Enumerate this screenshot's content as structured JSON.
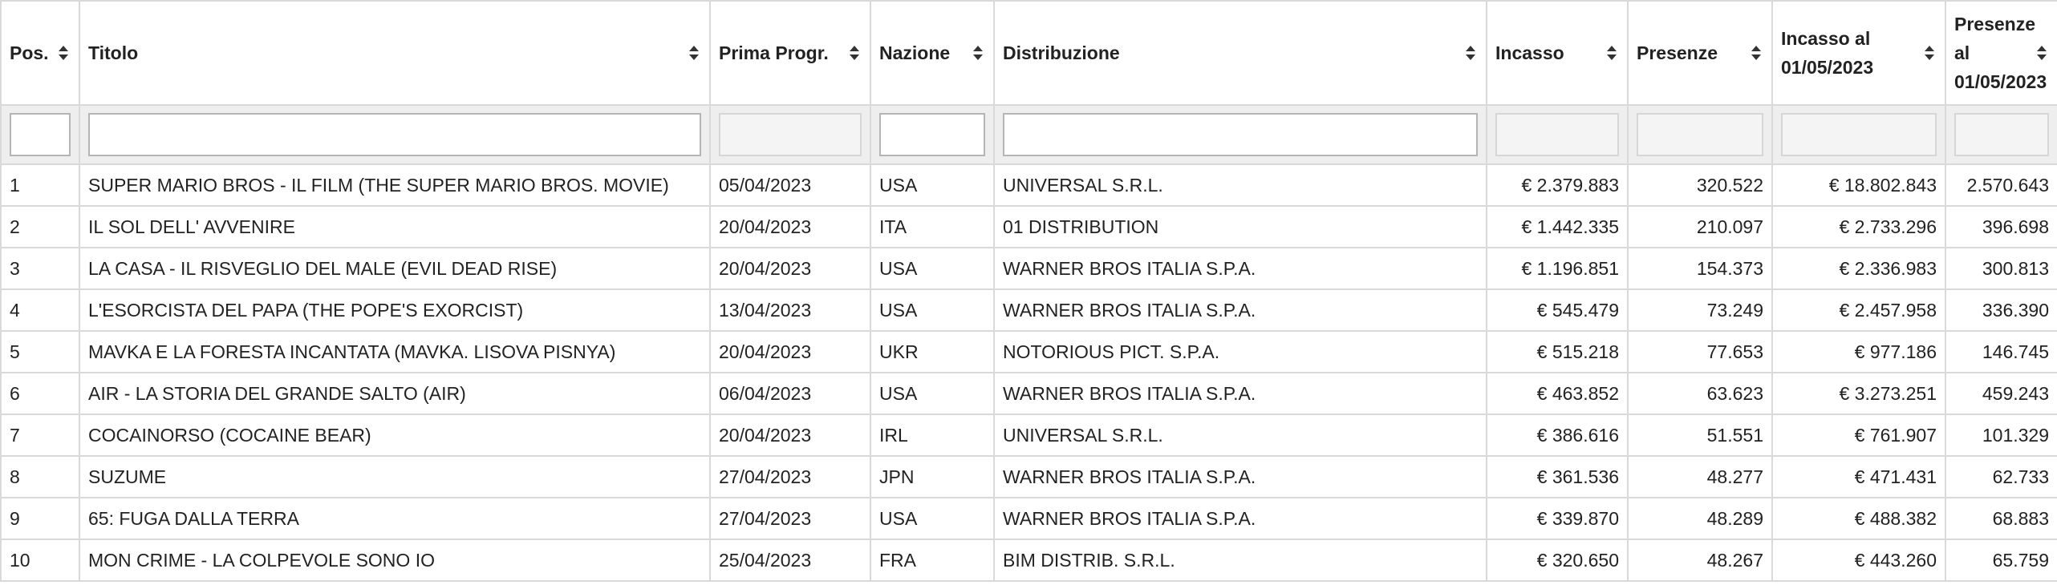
{
  "table": {
    "columns": [
      {
        "label": "Pos.",
        "align": "left"
      },
      {
        "label": "Titolo",
        "align": "left"
      },
      {
        "label": "Prima Progr.",
        "align": "left"
      },
      {
        "label": "Nazione",
        "align": "left"
      },
      {
        "label": "Distribuzione",
        "align": "left"
      },
      {
        "label": "Incasso",
        "align": "right"
      },
      {
        "label": "Presenze",
        "align": "right"
      },
      {
        "label": "Incasso al 01/05/2023",
        "align": "right"
      },
      {
        "label": "Presenze al 01/05/2023",
        "align": "right"
      }
    ],
    "filters": [
      {
        "value": "",
        "enabled": true
      },
      {
        "value": "",
        "enabled": true
      },
      {
        "value": "",
        "enabled": false
      },
      {
        "value": "",
        "enabled": true
      },
      {
        "value": "",
        "enabled": true
      },
      {
        "value": "",
        "enabled": false
      },
      {
        "value": "",
        "enabled": false
      },
      {
        "value": "",
        "enabled": false
      },
      {
        "value": "",
        "enabled": false
      }
    ],
    "rows": [
      [
        "1",
        "SUPER MARIO BROS - IL FILM (THE SUPER MARIO BROS. MOVIE)",
        "05/04/2023",
        "USA",
        "UNIVERSAL S.R.L.",
        "€ 2.379.883",
        "320.522",
        "€ 18.802.843",
        "2.570.643"
      ],
      [
        "2",
        "IL SOL DELL' AVVENIRE",
        "20/04/2023",
        "ITA",
        "01 DISTRIBUTION",
        "€ 1.442.335",
        "210.097",
        "€ 2.733.296",
        "396.698"
      ],
      [
        "3",
        "LA CASA - IL RISVEGLIO DEL MALE (EVIL DEAD RISE)",
        "20/04/2023",
        "USA",
        "WARNER BROS ITALIA S.P.A.",
        "€ 1.196.851",
        "154.373",
        "€ 2.336.983",
        "300.813"
      ],
      [
        "4",
        "L'ESORCISTA DEL PAPA (THE POPE'S EXORCIST)",
        "13/04/2023",
        "USA",
        "WARNER BROS ITALIA S.P.A.",
        "€ 545.479",
        "73.249",
        "€ 2.457.958",
        "336.390"
      ],
      [
        "5",
        "MAVKA E LA FORESTA INCANTATA (MAVKA. LISOVA PISNYA)",
        "20/04/2023",
        "UKR",
        "NOTORIOUS PICT. S.P.A.",
        "€ 515.218",
        "77.653",
        "€ 977.186",
        "146.745"
      ],
      [
        "6",
        "AIR - LA STORIA DEL GRANDE SALTO (AIR)",
        "06/04/2023",
        "USA",
        "WARNER BROS ITALIA S.P.A.",
        "€ 463.852",
        "63.623",
        "€ 3.273.251",
        "459.243"
      ],
      [
        "7",
        "COCAINORSO (COCAINE BEAR)",
        "20/04/2023",
        "IRL",
        "UNIVERSAL S.R.L.",
        "€ 386.616",
        "51.551",
        "€ 761.907",
        "101.329"
      ],
      [
        "8",
        "SUZUME",
        "27/04/2023",
        "JPN",
        "WARNER BROS ITALIA S.P.A.",
        "€ 361.536",
        "48.277",
        "€ 471.431",
        "62.733"
      ],
      [
        "9",
        "65: FUGA DALLA TERRA",
        "27/04/2023",
        "USA",
        "WARNER BROS ITALIA S.P.A.",
        "€ 339.870",
        "48.289",
        "€ 488.382",
        "68.883"
      ],
      [
        "10",
        "MON CRIME - LA COLPEVOLE SONO IO",
        "25/04/2023",
        "FRA",
        "BIM DISTRIB. S.R.L.",
        "€ 320.650",
        "48.267",
        "€ 443.260",
        "65.759"
      ]
    ]
  },
  "icons": {
    "sort": "sort-up-down-icon"
  },
  "colors": {
    "border": "#d9d9d9",
    "filter_bg": "#eeeeee",
    "text": "#222222"
  }
}
